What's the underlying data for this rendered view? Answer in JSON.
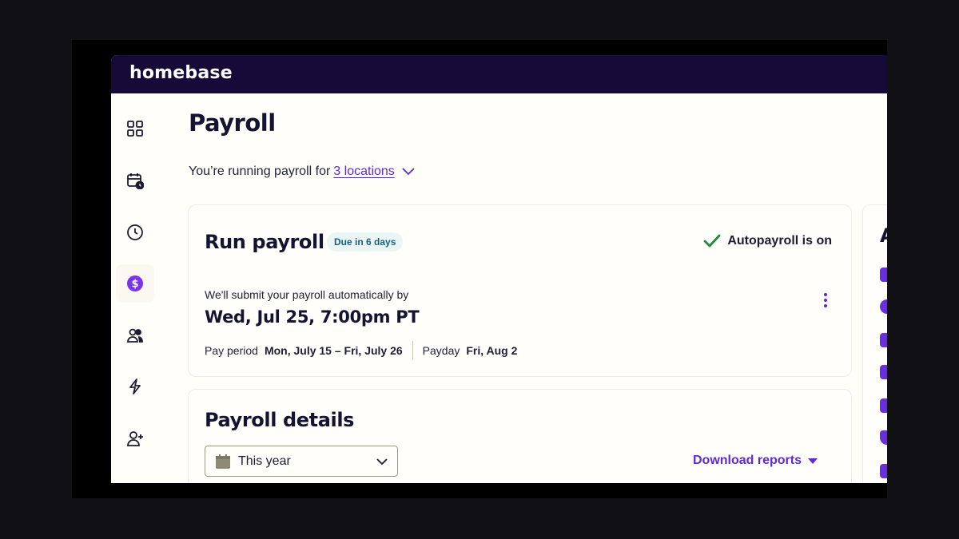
{
  "app": {
    "brand": "homebase"
  },
  "sidebar": {
    "items": [
      {
        "icon": "dashboard-icon",
        "active": false
      },
      {
        "icon": "schedule-icon",
        "active": false
      },
      {
        "icon": "clock-icon",
        "active": false
      },
      {
        "icon": "dollar-icon",
        "active": true
      },
      {
        "icon": "team-icon",
        "active": false
      },
      {
        "icon": "lightning-icon",
        "active": false
      },
      {
        "icon": "add-user-icon",
        "active": false
      }
    ]
  },
  "page": {
    "title": "Payroll",
    "subtitle_prefix": "You’re running payroll for",
    "locations_link": "3 locations"
  },
  "run_payroll": {
    "title": "Run payroll",
    "due_badge": "Due in 6 days",
    "autopayroll_status": "Autopayroll is on",
    "submit_note": "We'll submit your payroll automatically by",
    "submit_date": "Wed, Jul 25, 7:00pm PT",
    "pay_period_label": "Pay period",
    "pay_period_value": "Mon, July 15 – Fri, July 26",
    "payday_label": "Payday",
    "payday_value": "Fri, Aug 2"
  },
  "payroll_details": {
    "title": "Payroll details",
    "range_select": "This year",
    "download_label": "Download reports"
  },
  "side_panel": {
    "heading_initial": "A"
  },
  "colors": {
    "topbar": "#160b38",
    "accent": "#5c2bd6",
    "success": "#1f8a3a",
    "badge_bg": "#eaf6f6"
  }
}
